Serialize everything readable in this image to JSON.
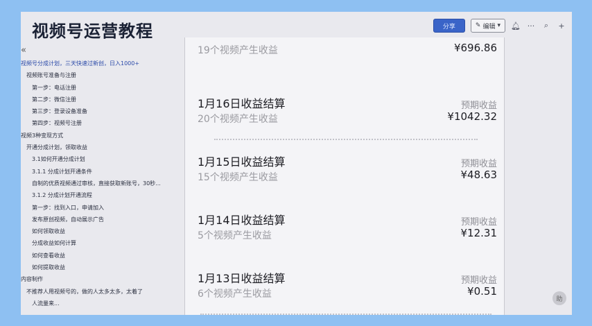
{
  "app_title": "视频号运营教程",
  "toolbar": {
    "share_label": "分享",
    "edit_label": "编辑",
    "edit_icon": "pencil-icon",
    "bell_icon": "bell-icon",
    "more_icon": "more-icon",
    "search_icon": "search-icon",
    "add_icon": "plus-icon"
  },
  "sidebar": {
    "collapse_label": "«",
    "items": [
      "视频号分成计划，三天快速过新创，日入1000+",
      "视频账号准备与注册",
      "第一步：电话注册",
      "第二步：微信注册",
      "第三步：登录设备准备",
      "第四步：视频号注册",
      "视频3种变现方式",
      "开通分成计划，领取收益",
      "3.1如何开通分成计划",
      "3.1.1 分成计划开通条件",
      "自制的优质视频通过审核，直接获取新账号，30秒...",
      "3.1.2 分成计划开通流程",
      "第一步：找到入口，申请加入",
      "发布原创视频，自动展示广告",
      "如何领取收益",
      "分成收益如何计算",
      "如何查看收益",
      "如何提取收益",
      "内容制作",
      "不推荐人用视频号的，做的人太多太多，太着了",
      "人流量来..."
    ]
  },
  "doc": {
    "first_count": "19个视频产生收益",
    "first_amount": "¥696.86",
    "days": [
      {
        "date": "1月16日收益结算",
        "label": "预期收益",
        "count": "20个视频产生收益",
        "amount": "¥1042.32"
      },
      {
        "date": "1月15日收益结算",
        "label": "预期收益",
        "count": "15个视频产生收益",
        "amount": "¥48.63"
      },
      {
        "date": "1月14日收益结算",
        "label": "预期收益",
        "count": "5个视频产生收益",
        "amount": "¥12.31"
      },
      {
        "date": "1月13日收益结算",
        "label": "预期收益",
        "count": "6个视频产生收益",
        "amount": "¥0.51"
      }
    ]
  },
  "avatar_text": "助"
}
